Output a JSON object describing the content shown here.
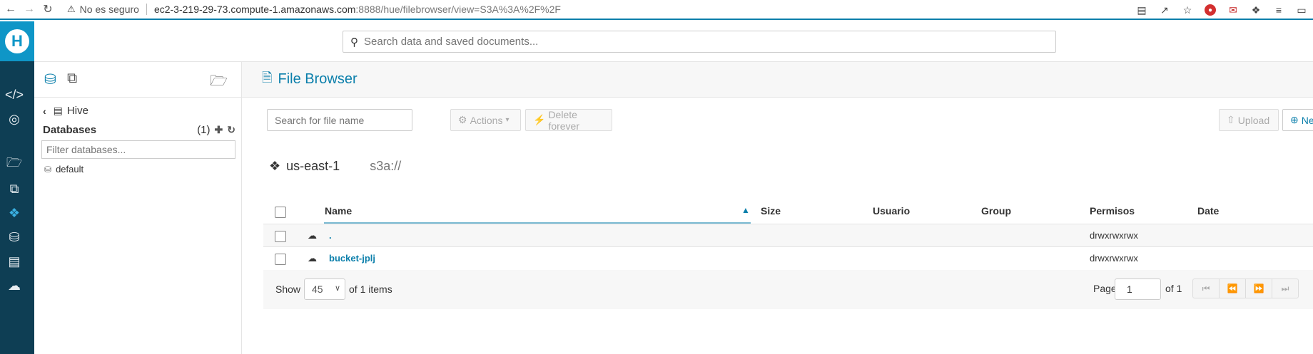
{
  "browser": {
    "insecure_label": "No es seguro",
    "url_host": "ec2-3-219-29-73.compute-1.amazonaws.com",
    "url_path": ":8888/hue/filebrowser/view=S3A%3A%2F%2F"
  },
  "global_search": {
    "placeholder": "Search data and saved documents..."
  },
  "assist": {
    "back_label": "Hive",
    "databases_title": "Databases",
    "databases_count": "(1)",
    "filter_placeholder": "Filter databases...",
    "items": [
      "default"
    ]
  },
  "main": {
    "title": "File Browser",
    "file_search_placeholder": "Search for file name",
    "actions_label": "Actions",
    "delete_label": "Delete forever",
    "upload_label": "Upload",
    "new_label": "Ne",
    "region": "us-east-1",
    "scheme": "s3a://"
  },
  "table": {
    "headers": {
      "name": "Name",
      "size": "Size",
      "user": "Usuario",
      "group": "Group",
      "perms": "Permisos",
      "date": "Date"
    },
    "rows": [
      {
        "name": ".",
        "perms": "drwxrwxrwx"
      },
      {
        "name": "bucket-jplj",
        "perms": "drwxrwxrwx"
      }
    ]
  },
  "pager": {
    "show_label": "Show",
    "page_size": "45",
    "items_label": "of 1 items",
    "page_label": "Page",
    "page_value": "1",
    "of_label": "of 1"
  },
  "colors": {
    "accent": "#0B7FAB",
    "rail": "#0e3e54",
    "logo": "#0f96c7"
  }
}
